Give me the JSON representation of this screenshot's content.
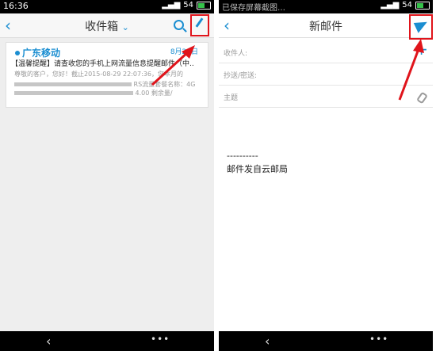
{
  "left_screen": {
    "status": {
      "time": "16:36",
      "battery": "54"
    },
    "navbar": {
      "title": "收件箱",
      "dropdown_glyph": "⌄"
    },
    "mail": {
      "sender": "广东移动",
      "date": "8月29日",
      "subject": "【温馨提醒】请查收您的手机上网流量信息提醒邮件（中..",
      "preview_line1": "尊敬的客户，您好！截止2015-08-29 22:07:36，您本月的",
      "preview_line2a": "RS流量套餐名称：4G",
      "preview_line3a": "4.00 剩余量/"
    }
  },
  "right_screen": {
    "status": {
      "notification": "已保存屏幕截图…",
      "battery": "54"
    },
    "navbar": {
      "title": "新邮件"
    },
    "compose": {
      "to_label": "收件人:",
      "cc_label": "抄送/密送:",
      "subject_label": "主题",
      "signature_dash": "----------",
      "signature": "邮件发自云邮局"
    }
  },
  "icons": [
    "back-icon",
    "search-icon",
    "compose-icon",
    "send-icon",
    "add-icon",
    "attachment-icon"
  ],
  "colors": {
    "accent": "#1b8ed1",
    "highlight": "#e0141b"
  }
}
